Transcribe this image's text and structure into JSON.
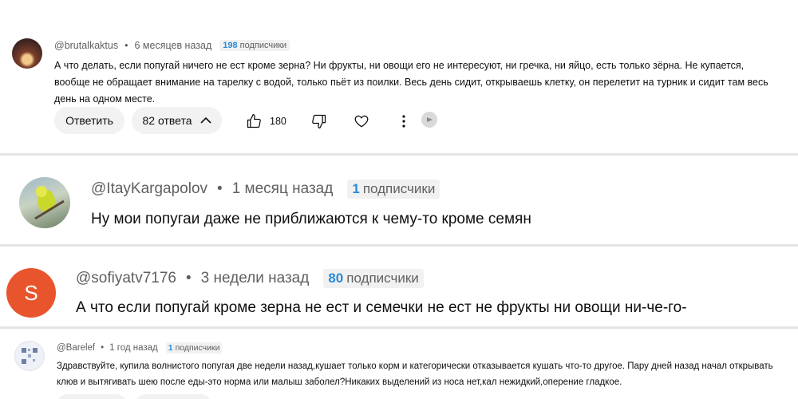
{
  "comments": [
    {
      "handle": "@brutalkaktus",
      "time": "6 месяцев назад",
      "subs_num": "198",
      "subs_label": "подписчики",
      "text": "А что делать, если попугай ничего не ест кроме зерна? Ни фрукты, ни овощи его не интересуют, ни гречка, ни яйцо, есть только зёрна. Не купается, вообще не обращает внимание на тарелку с водой, только пьёт из поилки. Весь день сидит, открываешь клетку, он перелетит на турник и сидит там весь день на одном месте.",
      "reply_label": "Ответить",
      "replies_label": "82 ответа",
      "likes": "180"
    },
    {
      "handle": "@ItayKargapolov",
      "time": "1 месяц назад",
      "subs_num": "1",
      "subs_label": "подписчики",
      "text": "Ну мои попугаи даже не приближаются к чему-то кроме семян"
    },
    {
      "handle": "@sofiyatv7176",
      "time": "3 недели назад",
      "subs_num": "80",
      "subs_label": "подписчики",
      "avatar_letter": "S",
      "text": "А что если попугай кроме зерна не ест и семечки не ест не фрукты ни овощи ни-че-го-"
    },
    {
      "handle": "@Barelef",
      "time": "1 год назад",
      "subs_num": "1",
      "subs_label": "подписчики",
      "text": "Здравствуйте, купила волнистого попугая две недели назад,кушает только корм и категорически отказывается кушать что-то другое. Пару дней назад начал открывать клюв и вытягивать шею после еды-это норма или малыш заболел?Никаких выделений из носа нет,кал нежидкий,оперение гладкое."
    }
  ],
  "icons": {
    "like": "thumb-up-icon",
    "dislike": "thumb-down-icon",
    "heart": "heart-icon",
    "more": "more-vert-icon",
    "chevron": "chevron-up-icon"
  },
  "colors": {
    "badge_number": "#2a8ad8",
    "letter_avatar": "#e8552d",
    "divider": "#e4e4e4"
  }
}
